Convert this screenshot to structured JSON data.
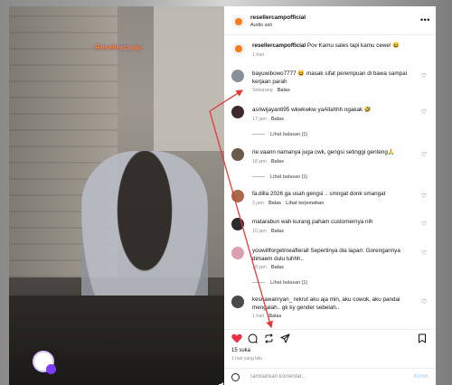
{
  "video": {
    "watermark": "Resellercamp",
    "sound_icon": "speaker-muted-icon"
  },
  "post": {
    "username": "resellercampofficial",
    "audio": "Audio asli",
    "caption_user": "resellercampofficial",
    "caption": "Pov Kamu sales tapi kamu cewe! 😆",
    "caption_time": "1 hari"
  },
  "comments": [
    {
      "user": "bayuwibowo7777",
      "text": "😆 masak sifat perempuan di bawa sampai kerjaan parah",
      "time": "Sekarang",
      "reply": "Balas",
      "avatar_color": "#8a9099"
    },
    {
      "user": "asriwijayanti95",
      "text": "wkwkwkw yaAllahhh ngakak 🤣",
      "time": "17 jam",
      "reply": "Balas",
      "view_replies": "Lihat balasan (1)",
      "avatar_color": "#3b2b2b"
    },
    {
      "user": "rie.vaann",
      "text": "namanya juga cwk, gengsi setinggi genteng🙏",
      "time": "18 jam",
      "reply": "Balas",
      "view_replies": "Lihat balasan (1)",
      "avatar_color": "#6b5a4a"
    },
    {
      "user": "fa.dilla 2026",
      "text": "ga usah gengsi .. smngat donk smangat",
      "time": "3 jam",
      "reply": "Balas",
      "translate": "Lihat terjemahan",
      "avatar_color": "#a86a4a"
    },
    {
      "user": "matarabun",
      "text": "wah kurang paham customernya nih",
      "time": "10 jam",
      "reply": "Balas",
      "avatar_color": "#2b2b2b"
    },
    {
      "user": "youwillforgetmeafterall",
      "text": "Sepertinya dia laparr. Gorengannya dimaem dulu tuhhh..",
      "time": "18 jam",
      "reply": "Balas",
      "view_replies": "Lihat balasan (1)",
      "avatar_color": "#d9a0b0"
    },
    {
      "user": "kesnawanryan_",
      "text": "rekrut aku aja min, aku cowok, aku pandai mengalah.. gk ky gender sebelah..",
      "time": "1 hari",
      "reply": "Balas",
      "avatar_color": "#4a4a4a"
    }
  ],
  "actions": {
    "like_icon": "heart-filled-icon",
    "comment_icon": "comment-icon",
    "repost_icon": "repost-icon",
    "share_icon": "send-icon",
    "save_icon": "bookmark-icon",
    "like_color": "#ed2c45"
  },
  "likes": "15 suka",
  "posted": "1 hari yang lalu",
  "add_comment": {
    "placeholder": "Tambahkan komentar...",
    "post_label": "Kirim",
    "emoji_icon": "emoji-icon"
  },
  "annotation": {
    "arrow_color": "#e53935"
  }
}
